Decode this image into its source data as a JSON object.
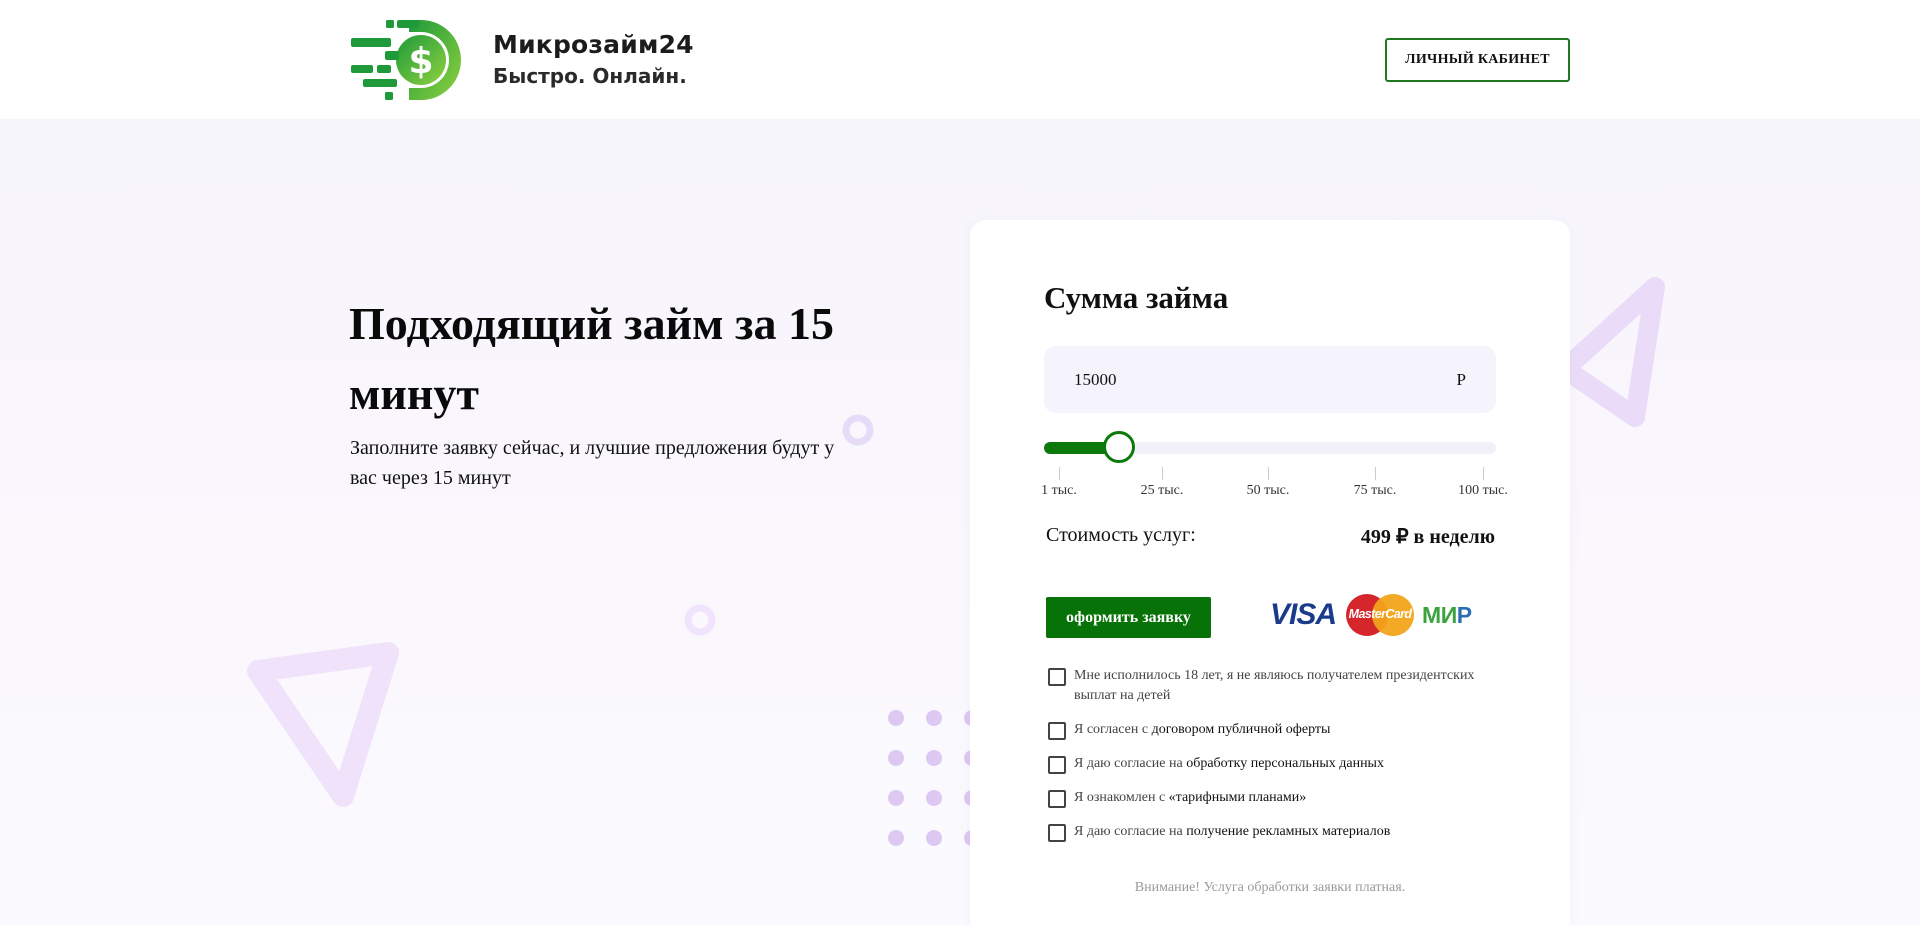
{
  "header": {
    "brand_title": "Микрозайм24",
    "brand_subtitle": "Быстро. Онлайн.",
    "cabinet_button": "ЛИЧНЫЙ КАБИНЕТ"
  },
  "hero": {
    "headline": "Подходящий займ за 15 минут",
    "subtext": "Заполните заявку сейчас, и лучшие предложения будут у вас через 15 минут"
  },
  "loan_form": {
    "title": "Сумма займа",
    "amount_value": "15000",
    "currency_symbol": "Р",
    "slider": {
      "value": 15000,
      "min": 1000,
      "max": 100000,
      "ticks": [
        "1 тыс.",
        "25 тыс.",
        "50 тыс.",
        "75 тыс.",
        "100 тыс."
      ]
    },
    "cost_label": "Стоимость услуг:",
    "cost_value": "499 ₽ в неделю",
    "apply_button": "оформить заявку",
    "payment_logos": {
      "visa": "VISA",
      "mastercard": "MasterCard",
      "mir_part1": "МИ",
      "mir_part2": "Р"
    },
    "checkboxes": [
      {
        "prefix": "Мне исполнилось 18 лет, я не являюсь получателем президентских выплат на детей",
        "link": ""
      },
      {
        "prefix": "Я согласен с ",
        "link": "договором публичной оферты"
      },
      {
        "prefix": "Я даю согласие на ",
        "link": "обработку персональных данных"
      },
      {
        "prefix": "Я ознакомлен с ",
        "link": "«тарифными планами»"
      },
      {
        "prefix": "Я даю согласие на ",
        "link": "получение рекламных материалов"
      }
    ],
    "warning": "Внимание! Услуга обработки заявки платная."
  },
  "colors": {
    "accent_green": "#077207",
    "logo_green": "#2ba23a",
    "decor_purple": "#e6d8f7"
  },
  "icons": {
    "logo": "dollar-coin-speed-icon"
  }
}
